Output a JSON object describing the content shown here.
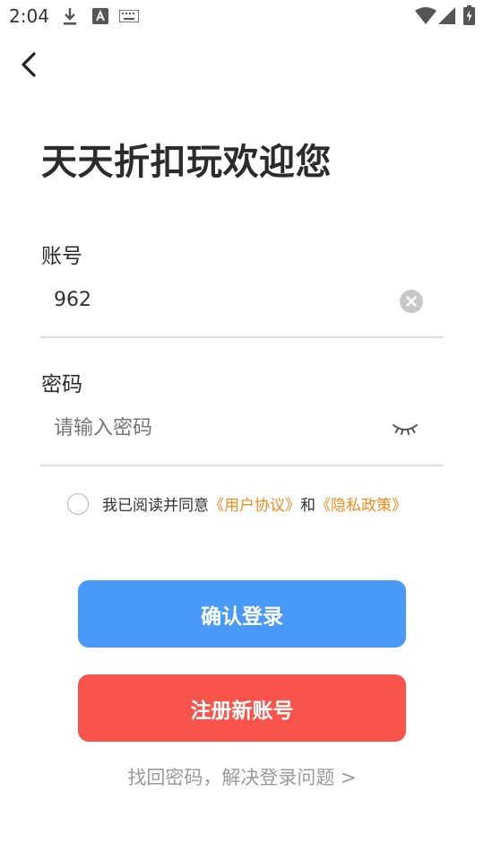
{
  "status_bar": {
    "time": "2:04",
    "icons": [
      "download-icon",
      "text-app-icon",
      "keyboard-icon",
      "wifi-icon",
      "cell-signal-icon",
      "battery-charging-icon"
    ]
  },
  "header": {
    "back_icon": "chevron-left-icon"
  },
  "title": "天天折扣玩欢迎您",
  "account": {
    "label": "账号",
    "value": "962",
    "clear_icon": "clear-icon"
  },
  "password": {
    "label": "密码",
    "placeholder": "请输入密码",
    "visibility_icon": "eye-closed-icon"
  },
  "agreement": {
    "checked": false,
    "prefix": "我已阅读并同意",
    "user_agreement": "《用户协议》",
    "and": "和",
    "privacy_policy": "《隐私政策》"
  },
  "buttons": {
    "login": "确认登录",
    "register": "注册新账号"
  },
  "recover_link": "找回密码，解决登录问题  >",
  "colors": {
    "primary": "#4899f8",
    "danger": "#f9544b",
    "link": "#f08a1c",
    "divider": "#dddddd"
  }
}
